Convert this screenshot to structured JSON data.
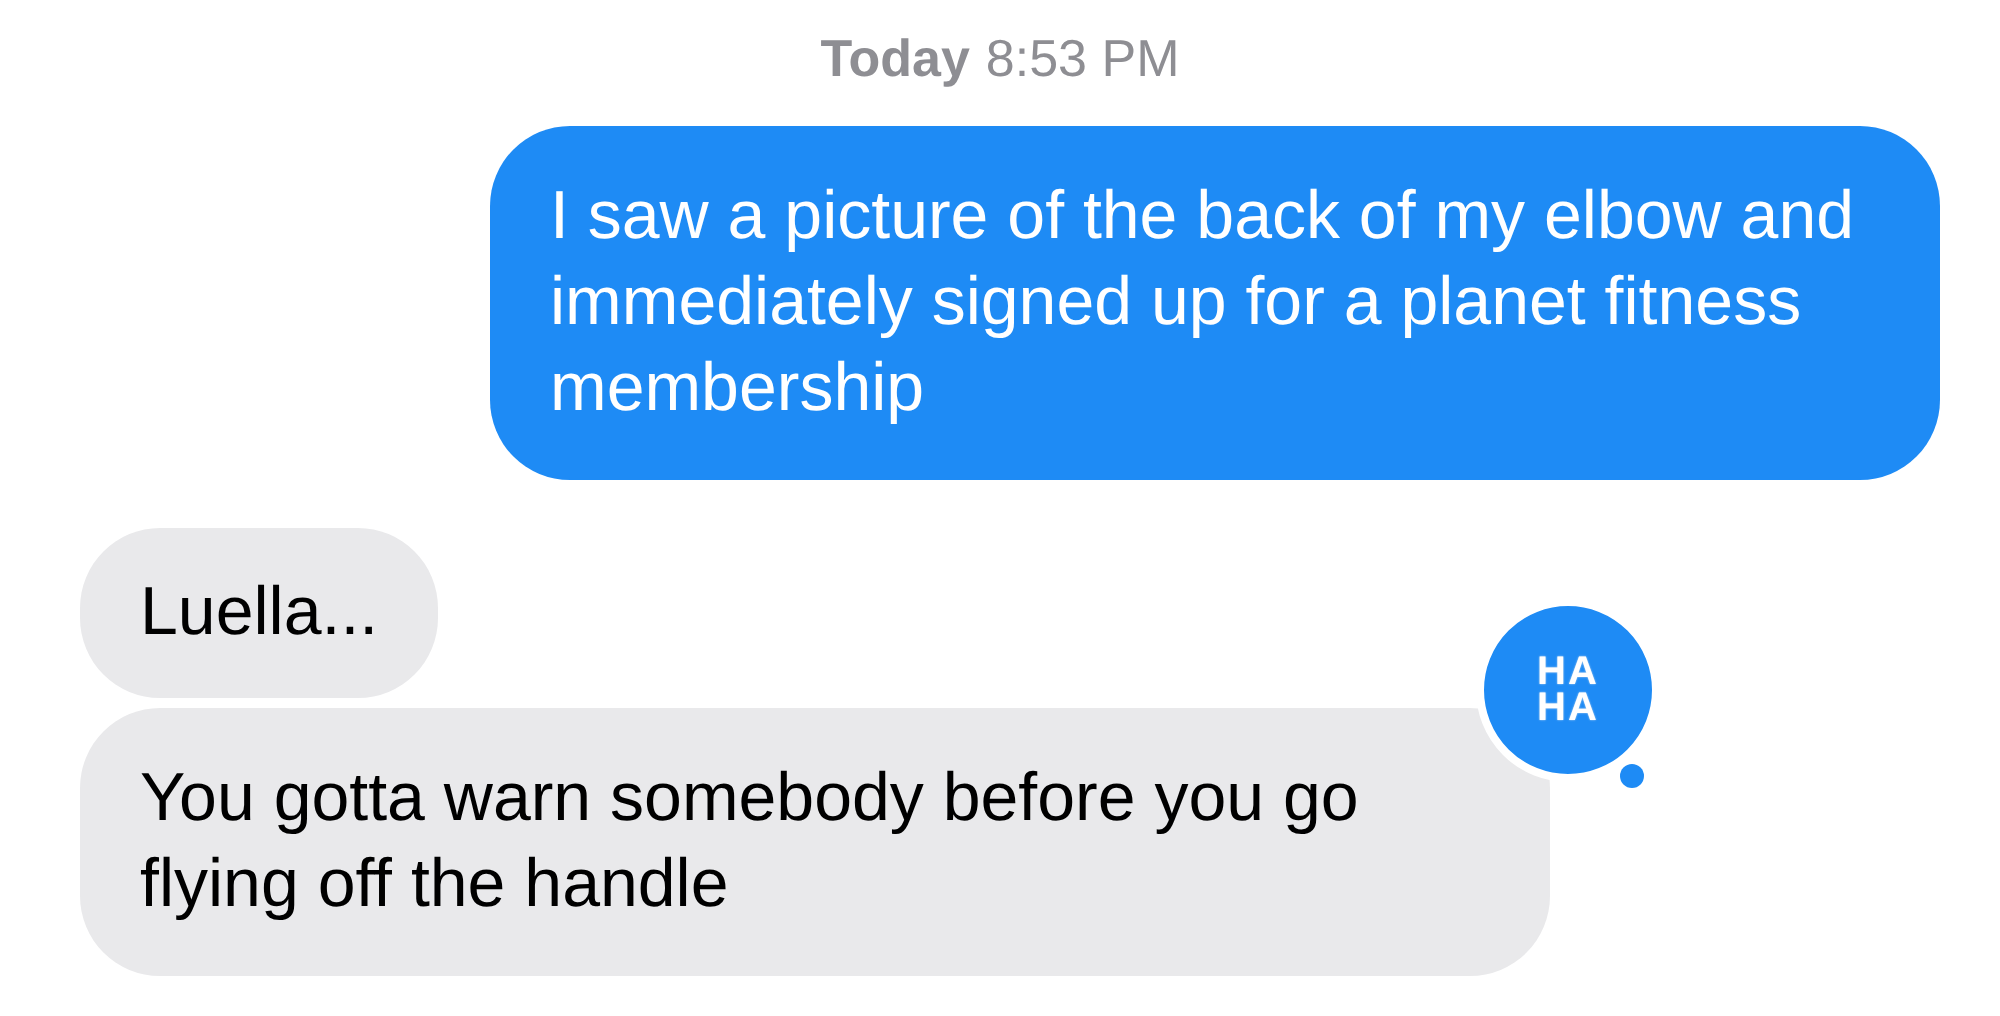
{
  "timestamp": {
    "day": "Today",
    "time": "8:53 PM"
  },
  "messages": [
    {
      "kind": "sent",
      "text": "I saw a picture of the back of my elbow and immediately signed up for a planet fitness membership"
    },
    {
      "kind": "received",
      "text": "Luella..."
    },
    {
      "kind": "received",
      "text": "You gotta warn somebody before you go flying off the handle",
      "reaction": {
        "lines": [
          "HA",
          "HA"
        ]
      }
    }
  ]
}
